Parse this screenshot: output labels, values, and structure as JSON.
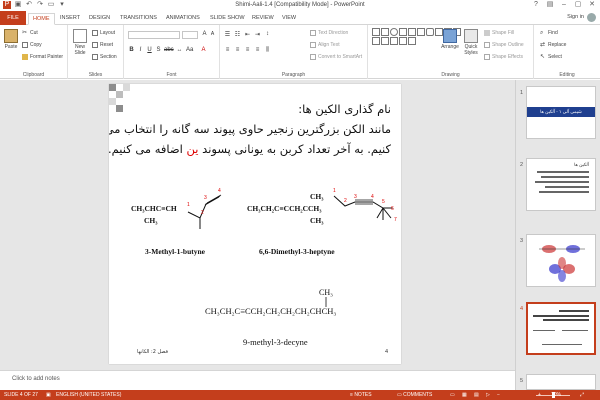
{
  "window": {
    "title": "Shimi-Aali-1.4 [Compatibility Mode] - PowerPoint",
    "sign_in": "Sign in"
  },
  "tabs": [
    "FILE",
    "HOME",
    "INSERT",
    "DESIGN",
    "TRANSITIONS",
    "ANIMATIONS",
    "SLIDE SHOW",
    "REVIEW",
    "VIEW"
  ],
  "active_tab": "HOME",
  "ribbon": {
    "clipboard": {
      "label": "Clipboard",
      "paste": "Paste",
      "cut": "Cut",
      "copy": "Copy",
      "format_painter": "Format Painter"
    },
    "slides": {
      "label": "Slides",
      "new_slide": "New Slide",
      "layout": "Layout",
      "reset": "Reset",
      "section": "Section"
    },
    "font": {
      "label": "Font"
    },
    "paragraph": {
      "label": "Paragraph",
      "text_direction": "Text Direction",
      "align_text": "Align Text",
      "convert_smartart": "Convert to SmartArt"
    },
    "drawing": {
      "label": "Drawing",
      "arrange": "Arrange",
      "quick_styles": "Quick Styles",
      "shape_fill": "Shape Fill",
      "shape_outline": "Shape Outline",
      "shape_effects": "Shape Effects"
    },
    "editing": {
      "label": "Editing",
      "find": "Find",
      "replace": "Replace",
      "select": "Select"
    }
  },
  "slide": {
    "heading": "نام گذاری الکین ها:",
    "body_line1": "مانند الکن بزرگترین زنجیر حاوی پیوند سه گانه را انتخاب می",
    "body_line2_a": "کنیم. به آخر تعداد کربن به یونانی پسوند",
    "body_line2_highlight": "ین",
    "body_line2_b": "اضافه می کنیم.",
    "formula1_top": "CH",
    "formula1": "CH₃CHC≡CH",
    "formula1_sub": "CH₃",
    "name1": "3-Methyl-1-butyne",
    "formula2": "CH₃CH₂C≡CCH₂CCH₃",
    "formula2_sub_top": "CH₃",
    "formula2_sub_bot": "CH₃",
    "name2": "6,6-Dimethyl-3-heptyne",
    "formula3_sub": "CH₃",
    "formula3": "CH₃CH₂C≡CCH₂CH₂CH₂CH₂CHCH₃",
    "name3": "9-methyl-3-decyne",
    "footer_left": "فصل 2: الکانها",
    "page_number": "4",
    "skeleton1_numbers": [
      "1",
      "2",
      "3",
      "4"
    ],
    "skeleton2_numbers": [
      "1",
      "2",
      "3",
      "4",
      "5",
      "6",
      "7"
    ]
  },
  "thumbnails": [
    {
      "num": "1",
      "title": "شیمی آلی ۱ - آلکین ها"
    },
    {
      "num": "2",
      "title": "آلکین ها"
    },
    {
      "num": "3",
      "title": ""
    },
    {
      "num": "4",
      "title": ""
    },
    {
      "num": "5",
      "title": ""
    }
  ],
  "notes_placeholder": "Click to add notes",
  "status": {
    "slide_of": "SLIDE 4 OF 27",
    "language": "ENGLISH (UNITED STATES)",
    "notes": "NOTES",
    "comments": "COMMENTS",
    "zoom": "70%"
  },
  "colors": {
    "accent": "#c43e1c",
    "title_bar_blue": "#1f3f8f",
    "highlight_red": "#dd0000"
  }
}
